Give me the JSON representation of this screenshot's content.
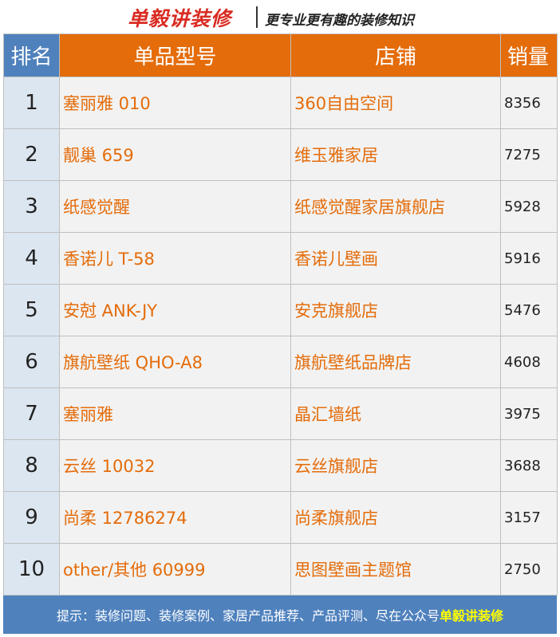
{
  "header": {
    "logo_text": "单毅讲装修",
    "tagline": "更专业更有趣的装修知识"
  },
  "table": {
    "columns": [
      "排名",
      "单品型号",
      "店铺",
      "销量"
    ],
    "rows": [
      {
        "rank": "1",
        "model": "塞丽雅 010",
        "shop": "360自由空间",
        "sales": "8356"
      },
      {
        "rank": "2",
        "model": "靓巢 659",
        "shop": "维玉雅家居",
        "sales": "7275"
      },
      {
        "rank": "3",
        "model": "纸感觉醒",
        "shop": "纸感觉醒家居旗舰店",
        "sales": "5928"
      },
      {
        "rank": "4",
        "model": "香诺儿 T-58",
        "shop": "香诺儿壁画",
        "sales": "5916"
      },
      {
        "rank": "5",
        "model": "安尅  ANK-JY",
        "shop": "安克旗舰店",
        "sales": "5476"
      },
      {
        "rank": "6",
        "model": "旗航壁纸 QHO-A8",
        "shop": "旗航壁纸品牌店",
        "sales": "4608"
      },
      {
        "rank": "7",
        "model": "塞丽雅",
        "shop": "晶汇墙纸",
        "sales": "3975"
      },
      {
        "rank": "8",
        "model": "云丝 10032",
        "shop": "云丝旗舰店",
        "sales": "3688"
      },
      {
        "rank": "9",
        "model": "尚柔 12786274",
        "shop": "尚柔旗舰店",
        "sales": "3157"
      },
      {
        "rank": "10",
        "model": "other/其他 60999",
        "shop": "思图壁画主题馆",
        "sales": "2750"
      }
    ]
  },
  "footer": {
    "text": "提示：装修问题、装修案例、家居产品推荐、产品评测、尽在公众号",
    "highlight": "单毅讲装修"
  },
  "colors": {
    "orange": "#e46c0a",
    "blue": "#4f81bd",
    "light_blue": "#dce6f1",
    "cell_gray": "#f2f2f2",
    "logo_red": "#d92b22",
    "highlight_yellow": "#ffff00"
  }
}
